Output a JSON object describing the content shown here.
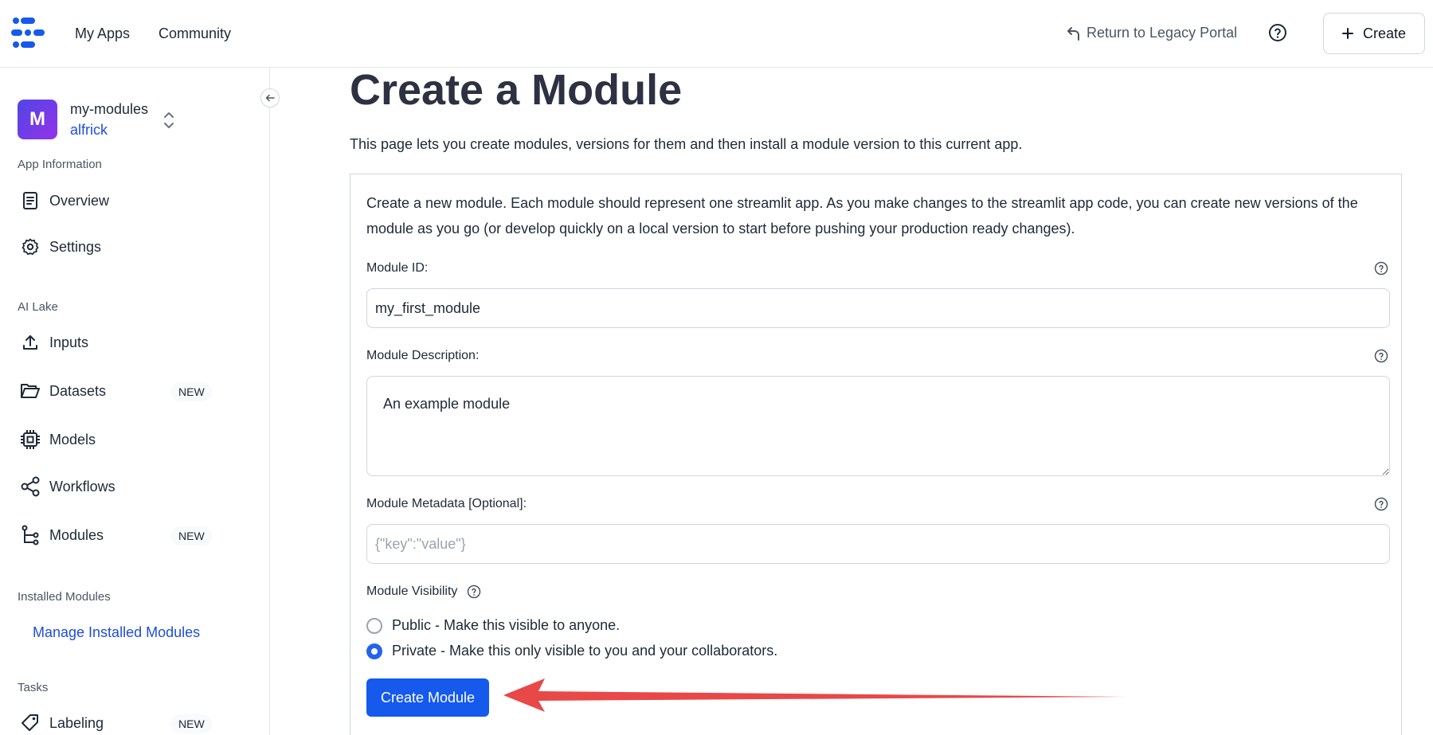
{
  "topbar": {
    "nav": {
      "my_apps": "My Apps",
      "community": "Community"
    },
    "return_label": "Return to Legacy Portal",
    "create_label": "Create"
  },
  "sidebar": {
    "app": {
      "avatar_letter": "M",
      "name": "my-modules",
      "user": "alfrick"
    },
    "sections": {
      "app_information": "App Information",
      "ai_lake": "AI Lake",
      "installed_modules": "Installed Modules",
      "tasks": "Tasks"
    },
    "items": {
      "overview": "Overview",
      "settings": "Settings",
      "inputs": "Inputs",
      "datasets": "Datasets",
      "models": "Models",
      "workflows": "Workflows",
      "modules": "Modules",
      "labeling": "Labeling"
    },
    "badge_new": "NEW",
    "manage_link": "Manage Installed Modules"
  },
  "main": {
    "title": "Create a Module",
    "description": "This page lets you create modules, versions for them and then install a module version to this current app.",
    "card": {
      "intro": "Create a new module. Each module should represent one streamlit app. As you make changes to the streamlit app code, you can create new versions of the module as you go (or develop quickly on a local version to start before pushing your production ready changes).",
      "module_id": {
        "label": "Module ID:",
        "value": "my_first_module"
      },
      "module_description": {
        "label": "Module Description:",
        "value": "An example module"
      },
      "module_metadata": {
        "label": "Module Metadata [Optional]:",
        "placeholder": "{\"key\":\"value\"}"
      },
      "visibility": {
        "label": "Module Visibility",
        "options": [
          "Public - Make this visible to anyone.",
          "Private - Make this only visible to you and your collaborators."
        ],
        "selected": 1
      },
      "submit_label": "Create Module"
    }
  },
  "colors": {
    "accent": "#1559ed",
    "link": "#1d4ed8",
    "annotation_arrow": "#e84848"
  }
}
